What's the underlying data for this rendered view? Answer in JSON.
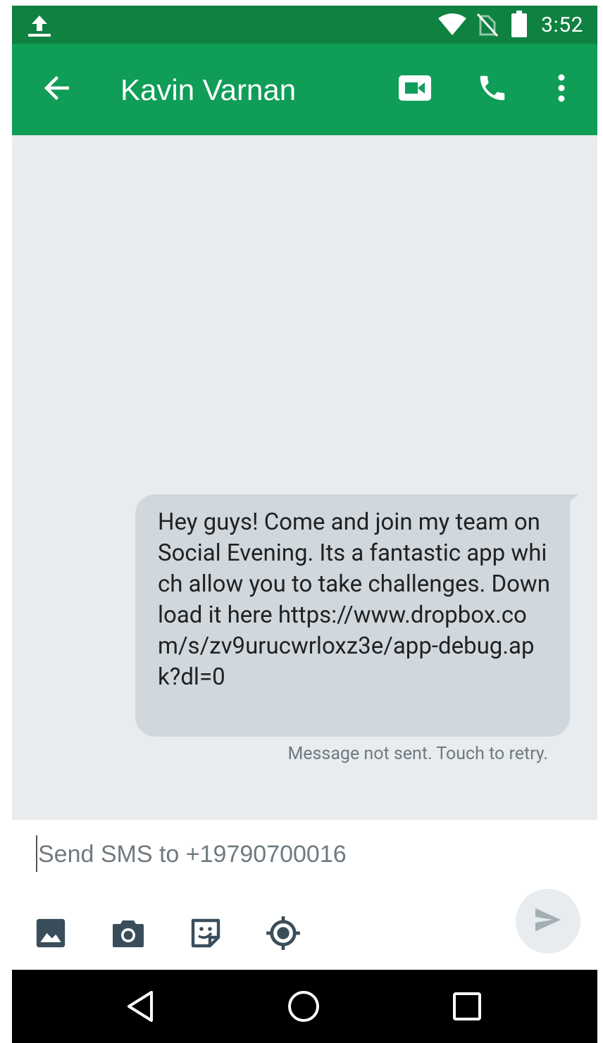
{
  "status_bar": {
    "time": "3:52",
    "icons": [
      "upload-icon",
      "wifi-icon",
      "no-sim-icon",
      "battery-icon"
    ]
  },
  "app_bar": {
    "title": "Kavin Varnan",
    "icons": [
      "back-arrow-icon",
      "video-call-icon",
      "phone-icon",
      "more-vert-icon"
    ],
    "color": "#0f9d58",
    "status_color": "#0f8141"
  },
  "conversation": {
    "messages": [
      {
        "text": "Hey guys! Come and join my team on Social Evening. Its a fantastic app which allow you to take challenges. Download it here https://www.dropbox.com/s/zv9urucwrloxz3e/app-debug.apk?dl=0",
        "status": "Message not sent. Touch to retry."
      }
    ],
    "background": "#e8ecef",
    "bubble_color": "#d0d8de"
  },
  "composer": {
    "placeholder": "Send SMS to +19790700016",
    "value": "",
    "attachments": [
      "image-icon",
      "camera-icon",
      "sticker-icon",
      "location-icon"
    ],
    "send_icon": "send-icon"
  },
  "nav_bar": {
    "icons": [
      "back-triangle-icon",
      "home-circle-icon",
      "recents-square-icon"
    ]
  }
}
